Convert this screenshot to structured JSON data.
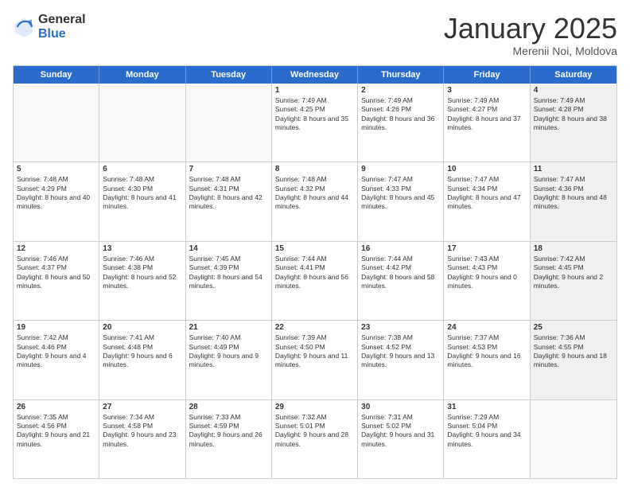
{
  "logo": {
    "general": "General",
    "blue": "Blue"
  },
  "header": {
    "month": "January 2025",
    "location": "Merenii Noi, Moldova"
  },
  "weekdays": [
    "Sunday",
    "Monday",
    "Tuesday",
    "Wednesday",
    "Thursday",
    "Friday",
    "Saturday"
  ],
  "weeks": [
    [
      {
        "day": "",
        "empty": true
      },
      {
        "day": "",
        "empty": true
      },
      {
        "day": "",
        "empty": true
      },
      {
        "day": "1",
        "sunrise": "Sunrise: 7:49 AM",
        "sunset": "Sunset: 4:25 PM",
        "daylight": "Daylight: 8 hours and 35 minutes."
      },
      {
        "day": "2",
        "sunrise": "Sunrise: 7:49 AM",
        "sunset": "Sunset: 4:26 PM",
        "daylight": "Daylight: 8 hours and 36 minutes."
      },
      {
        "day": "3",
        "sunrise": "Sunrise: 7:49 AM",
        "sunset": "Sunset: 4:27 PM",
        "daylight": "Daylight: 8 hours and 37 minutes."
      },
      {
        "day": "4",
        "sunrise": "Sunrise: 7:49 AM",
        "sunset": "Sunset: 4:28 PM",
        "daylight": "Daylight: 8 hours and 38 minutes.",
        "shaded": true
      }
    ],
    [
      {
        "day": "5",
        "sunrise": "Sunrise: 7:48 AM",
        "sunset": "Sunset: 4:29 PM",
        "daylight": "Daylight: 8 hours and 40 minutes."
      },
      {
        "day": "6",
        "sunrise": "Sunrise: 7:48 AM",
        "sunset": "Sunset: 4:30 PM",
        "daylight": "Daylight: 8 hours and 41 minutes."
      },
      {
        "day": "7",
        "sunrise": "Sunrise: 7:48 AM",
        "sunset": "Sunset: 4:31 PM",
        "daylight": "Daylight: 8 hours and 42 minutes."
      },
      {
        "day": "8",
        "sunrise": "Sunrise: 7:48 AM",
        "sunset": "Sunset: 4:32 PM",
        "daylight": "Daylight: 8 hours and 44 minutes."
      },
      {
        "day": "9",
        "sunrise": "Sunrise: 7:47 AM",
        "sunset": "Sunset: 4:33 PM",
        "daylight": "Daylight: 8 hours and 45 minutes."
      },
      {
        "day": "10",
        "sunrise": "Sunrise: 7:47 AM",
        "sunset": "Sunset: 4:34 PM",
        "daylight": "Daylight: 8 hours and 47 minutes."
      },
      {
        "day": "11",
        "sunrise": "Sunrise: 7:47 AM",
        "sunset": "Sunset: 4:36 PM",
        "daylight": "Daylight: 8 hours and 48 minutes.",
        "shaded": true
      }
    ],
    [
      {
        "day": "12",
        "sunrise": "Sunrise: 7:46 AM",
        "sunset": "Sunset: 4:37 PM",
        "daylight": "Daylight: 8 hours and 50 minutes."
      },
      {
        "day": "13",
        "sunrise": "Sunrise: 7:46 AM",
        "sunset": "Sunset: 4:38 PM",
        "daylight": "Daylight: 8 hours and 52 minutes."
      },
      {
        "day": "14",
        "sunrise": "Sunrise: 7:45 AM",
        "sunset": "Sunset: 4:39 PM",
        "daylight": "Daylight: 8 hours and 54 minutes."
      },
      {
        "day": "15",
        "sunrise": "Sunrise: 7:44 AM",
        "sunset": "Sunset: 4:41 PM",
        "daylight": "Daylight: 8 hours and 56 minutes."
      },
      {
        "day": "16",
        "sunrise": "Sunrise: 7:44 AM",
        "sunset": "Sunset: 4:42 PM",
        "daylight": "Daylight: 8 hours and 58 minutes."
      },
      {
        "day": "17",
        "sunrise": "Sunrise: 7:43 AM",
        "sunset": "Sunset: 4:43 PM",
        "daylight": "Daylight: 9 hours and 0 minutes."
      },
      {
        "day": "18",
        "sunrise": "Sunrise: 7:42 AM",
        "sunset": "Sunset: 4:45 PM",
        "daylight": "Daylight: 9 hours and 2 minutes.",
        "shaded": true
      }
    ],
    [
      {
        "day": "19",
        "sunrise": "Sunrise: 7:42 AM",
        "sunset": "Sunset: 4:46 PM",
        "daylight": "Daylight: 9 hours and 4 minutes."
      },
      {
        "day": "20",
        "sunrise": "Sunrise: 7:41 AM",
        "sunset": "Sunset: 4:48 PM",
        "daylight": "Daylight: 9 hours and 6 minutes."
      },
      {
        "day": "21",
        "sunrise": "Sunrise: 7:40 AM",
        "sunset": "Sunset: 4:49 PM",
        "daylight": "Daylight: 9 hours and 9 minutes."
      },
      {
        "day": "22",
        "sunrise": "Sunrise: 7:39 AM",
        "sunset": "Sunset: 4:50 PM",
        "daylight": "Daylight: 9 hours and 11 minutes."
      },
      {
        "day": "23",
        "sunrise": "Sunrise: 7:38 AM",
        "sunset": "Sunset: 4:52 PM",
        "daylight": "Daylight: 9 hours and 13 minutes."
      },
      {
        "day": "24",
        "sunrise": "Sunrise: 7:37 AM",
        "sunset": "Sunset: 4:53 PM",
        "daylight": "Daylight: 9 hours and 16 minutes."
      },
      {
        "day": "25",
        "sunrise": "Sunrise: 7:36 AM",
        "sunset": "Sunset: 4:55 PM",
        "daylight": "Daylight: 9 hours and 18 minutes.",
        "shaded": true
      }
    ],
    [
      {
        "day": "26",
        "sunrise": "Sunrise: 7:35 AM",
        "sunset": "Sunset: 4:56 PM",
        "daylight": "Daylight: 9 hours and 21 minutes."
      },
      {
        "day": "27",
        "sunrise": "Sunrise: 7:34 AM",
        "sunset": "Sunset: 4:58 PM",
        "daylight": "Daylight: 9 hours and 23 minutes."
      },
      {
        "day": "28",
        "sunrise": "Sunrise: 7:33 AM",
        "sunset": "Sunset: 4:59 PM",
        "daylight": "Daylight: 9 hours and 26 minutes."
      },
      {
        "day": "29",
        "sunrise": "Sunrise: 7:32 AM",
        "sunset": "Sunset: 5:01 PM",
        "daylight": "Daylight: 9 hours and 28 minutes."
      },
      {
        "day": "30",
        "sunrise": "Sunrise: 7:31 AM",
        "sunset": "Sunset: 5:02 PM",
        "daylight": "Daylight: 9 hours and 31 minutes."
      },
      {
        "day": "31",
        "sunrise": "Sunrise: 7:29 AM",
        "sunset": "Sunset: 5:04 PM",
        "daylight": "Daylight: 9 hours and 34 minutes."
      },
      {
        "day": "",
        "empty": true,
        "shaded": true
      }
    ]
  ]
}
